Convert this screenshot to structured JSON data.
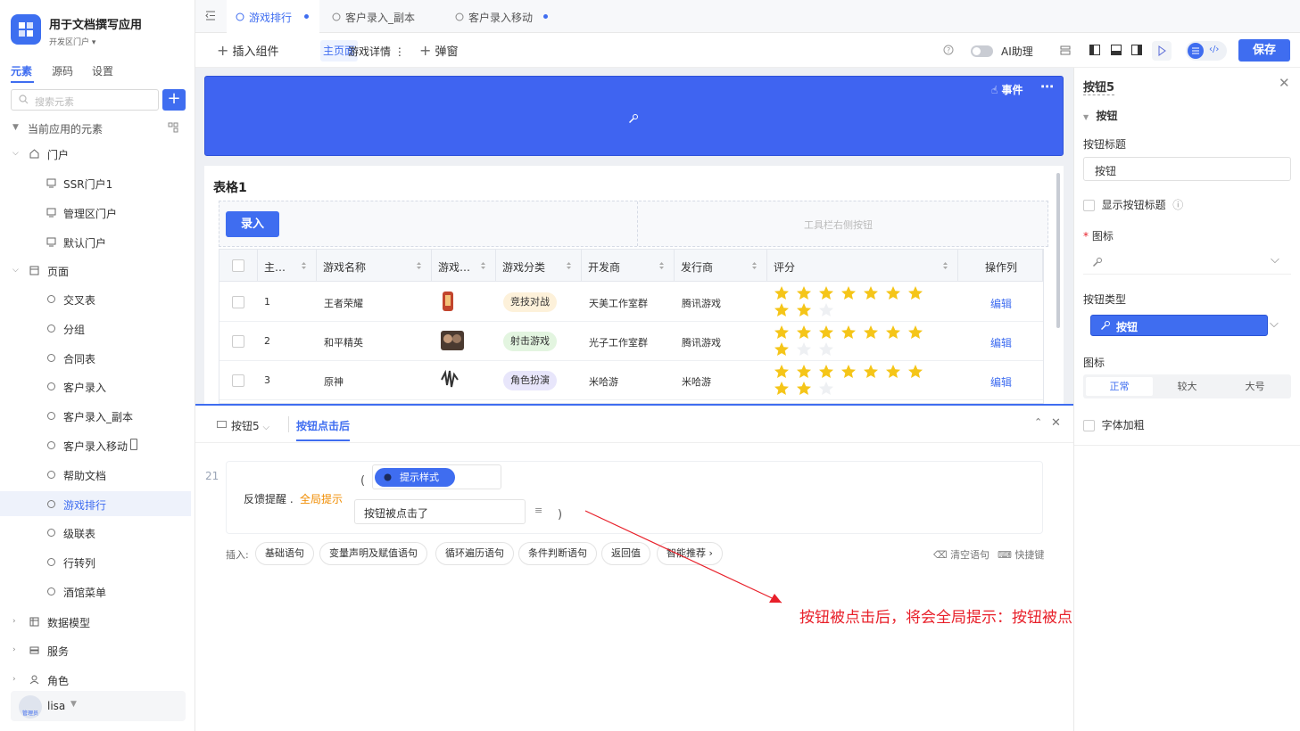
{
  "app": {
    "name": "用于文档撰写应用",
    "subtitle": "开发区门户"
  },
  "left_tabs": [
    "元素",
    "源码",
    "设置"
  ],
  "search": {
    "placeholder": "搜索元素"
  },
  "tree_header": "当前应用的元素",
  "tree": {
    "portal_group": "门户",
    "portals": [
      "SSR门户1",
      "管理区门户",
      "默认门户"
    ],
    "pages_group": "页面",
    "pages": [
      "交叉表",
      "分组",
      "合同表",
      "客户录入",
      "客户录入_副本",
      "客户录入移动",
      "帮助文档",
      "游戏排行",
      "级联表",
      "行转列",
      "酒馆菜单"
    ],
    "others": [
      "数据模型",
      "服务",
      "角色"
    ]
  },
  "user": {
    "name": "lisa",
    "role": "管理员"
  },
  "top_tabs": [
    {
      "label": "游戏排行",
      "dirty": true
    },
    {
      "label": "客户录入_副本",
      "dirty": false
    },
    {
      "label": "客户录入移动",
      "dirty": true
    }
  ],
  "toolbar": {
    "insert": "插入组件",
    "main_page": "主页面",
    "game_detail": "游戏详情",
    "popup": "弹窗",
    "ai_assistant": "AI助理",
    "save": "保存"
  },
  "blue_panel": {
    "event": "事件"
  },
  "table": {
    "title": "表格1",
    "entry_button": "录入",
    "toolbar_right": "工具栏右侧按钮",
    "columns": [
      "主…",
      "游戏名称",
      "游戏…",
      "游戏分类",
      "开发商",
      "发行商",
      "评分",
      "操作列"
    ],
    "rows": [
      {
        "id": "1",
        "name": "王者荣耀",
        "category": "竞技对战",
        "developer": "天美工作室群",
        "publisher": "腾讯游戏",
        "rating": 9,
        "action": "编辑"
      },
      {
        "id": "2",
        "name": "和平精英",
        "category": "射击游戏",
        "developer": "光子工作室群",
        "publisher": "腾讯游戏",
        "rating": 8,
        "action": "编辑"
      },
      {
        "id": "3",
        "name": "原神",
        "category": "角色扮演",
        "developer": "米哈游",
        "publisher": "米哈游",
        "rating": 9,
        "action": "编辑"
      }
    ],
    "tag_colors": [
      "#fdf1da",
      "#e3f5e0",
      "#e8e6fb"
    ]
  },
  "editor": {
    "target": "按钮5",
    "event_tab": "按钮点击后",
    "line_no": "21",
    "statement_prefix": "反馈提醒 .",
    "statement_method": "全局提示",
    "param_style": "提示样式",
    "param_text": "按钮被点击了",
    "insert_label": "插入:",
    "chips": [
      "基础语句",
      "变量声明及赋值语句",
      "循环遍历语句",
      "条件判断语句",
      "返回值",
      "智能推荐 ›"
    ],
    "clear": "清空语句",
    "shortcut": "快捷键"
  },
  "right_panel": {
    "title": "按钮5",
    "section": "按钮",
    "caption_label": "按钮标题",
    "caption_value": "按钮",
    "show_caption": "显示按钮标题",
    "icon_label": "图标",
    "type_label": "按钮类型",
    "type_value": "按钮",
    "size_label": "图标",
    "sizes": [
      "正常",
      "较大",
      "大号"
    ],
    "bold": "字体加粗"
  },
  "annotation": "按钮被点击后，将会全局提示：按钮被点击了",
  "colors": {
    "accent": "#3f6df0",
    "panel_blue": "#3f64f1",
    "star": "#f5c518",
    "annotation": "#e8202a"
  }
}
